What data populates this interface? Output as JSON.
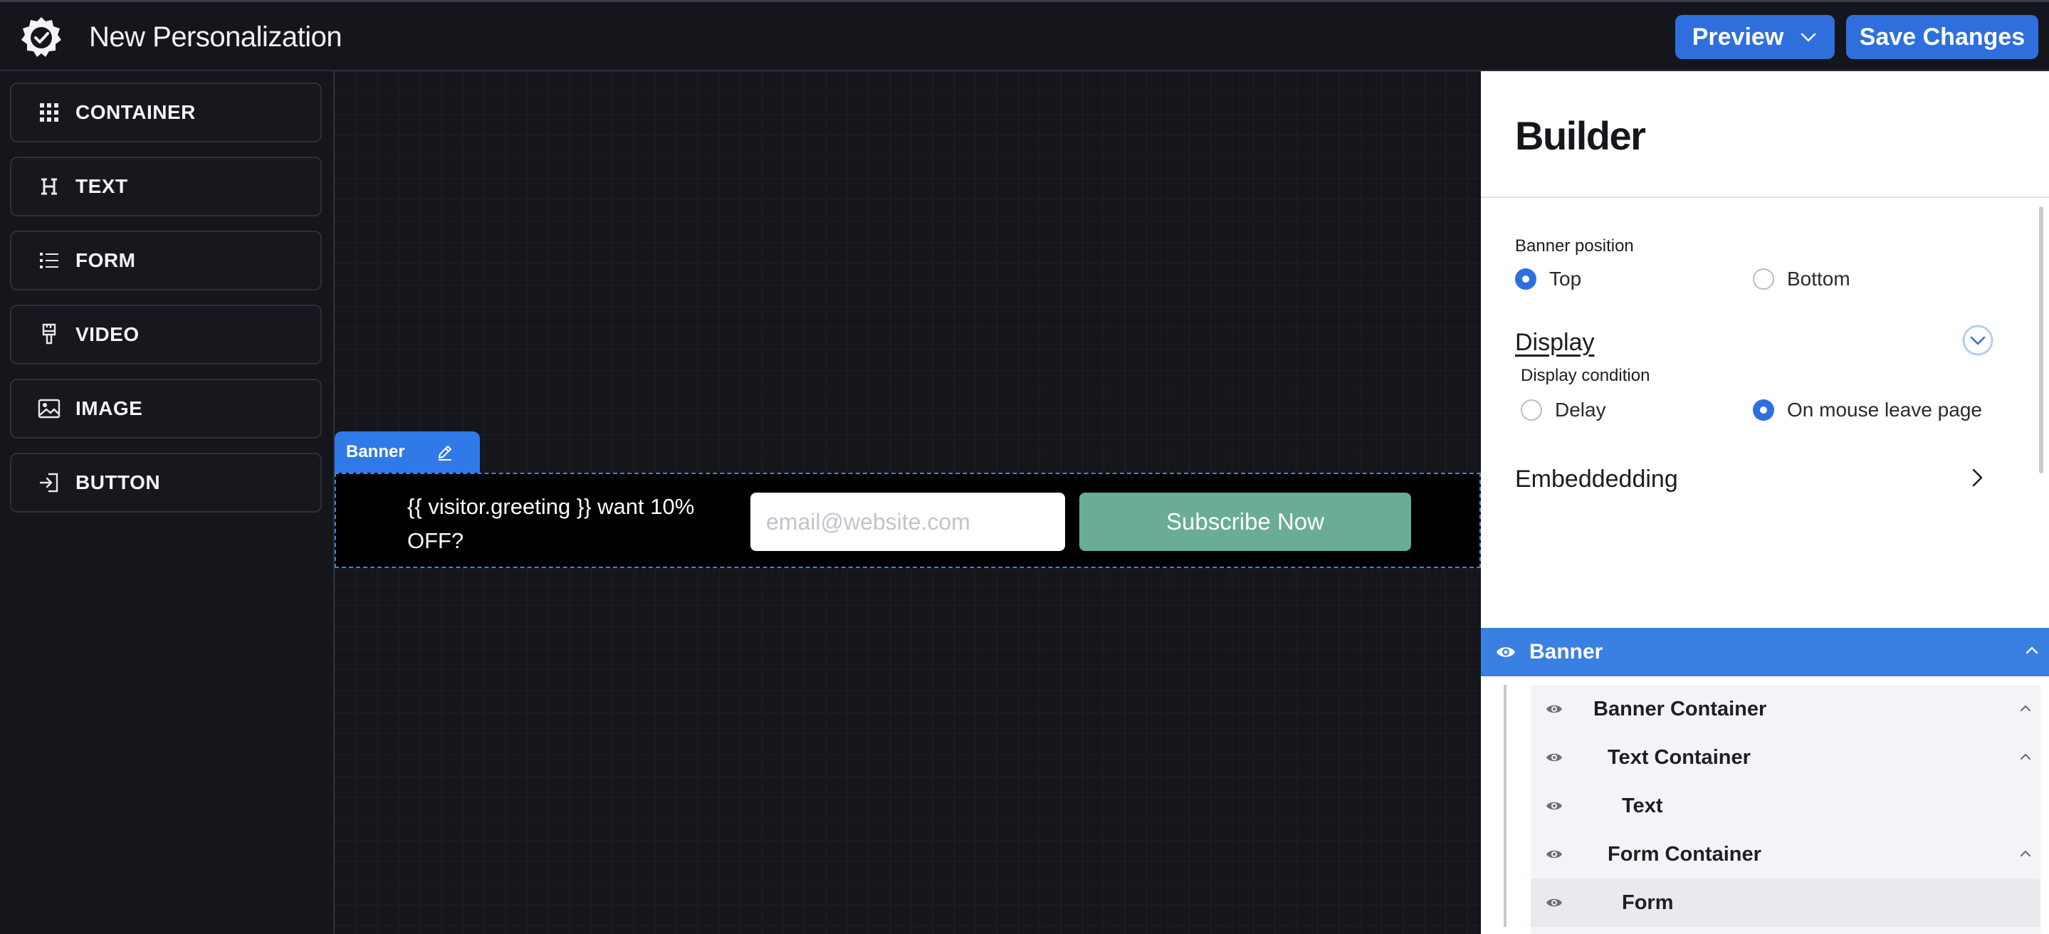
{
  "header": {
    "title": "New Personalization",
    "preview_label": "Preview",
    "save_label": "Save Changes"
  },
  "palette": [
    {
      "label": "CONTAINER",
      "icon": "grid-icon"
    },
    {
      "label": "TEXT",
      "icon": "heading-icon"
    },
    {
      "label": "FORM",
      "icon": "list-icon"
    },
    {
      "label": "VIDEO",
      "icon": "brush-icon"
    },
    {
      "label": "IMAGE",
      "icon": "image-icon"
    },
    {
      "label": "BUTTON",
      "icon": "login-icon"
    }
  ],
  "canvas": {
    "banner_tab_label": "Banner",
    "banner_text": "{{ visitor.greeting }} want 10% OFF?",
    "email_placeholder": "email@website.com",
    "subscribe_label": "Subscribe Now"
  },
  "builder": {
    "title": "Builder",
    "banner_position_label": "Banner position",
    "position_options": [
      {
        "label": "Top",
        "selected": true
      },
      {
        "label": "Bottom",
        "selected": false
      }
    ],
    "display_title": "Display",
    "display_condition_label": "Display condition",
    "condition_options": [
      {
        "label": "Delay",
        "selected": false
      },
      {
        "label": "On mouse leave page",
        "selected": true
      }
    ],
    "embedding_title": "Embeddedding"
  },
  "layers": {
    "root": "Banner",
    "items": [
      {
        "label": "Banner Container",
        "expandable": true
      },
      {
        "label": "Text Container",
        "expandable": true
      },
      {
        "label": "Text",
        "expandable": false
      },
      {
        "label": "Form Container",
        "expandable": true
      },
      {
        "label": "Form",
        "expandable": false
      }
    ]
  },
  "colors": {
    "accent": "#2f6fdd",
    "canvas_bg": "#15161c",
    "subscribe_bg": "#6aac96",
    "layer_header": "#3a80e3"
  }
}
